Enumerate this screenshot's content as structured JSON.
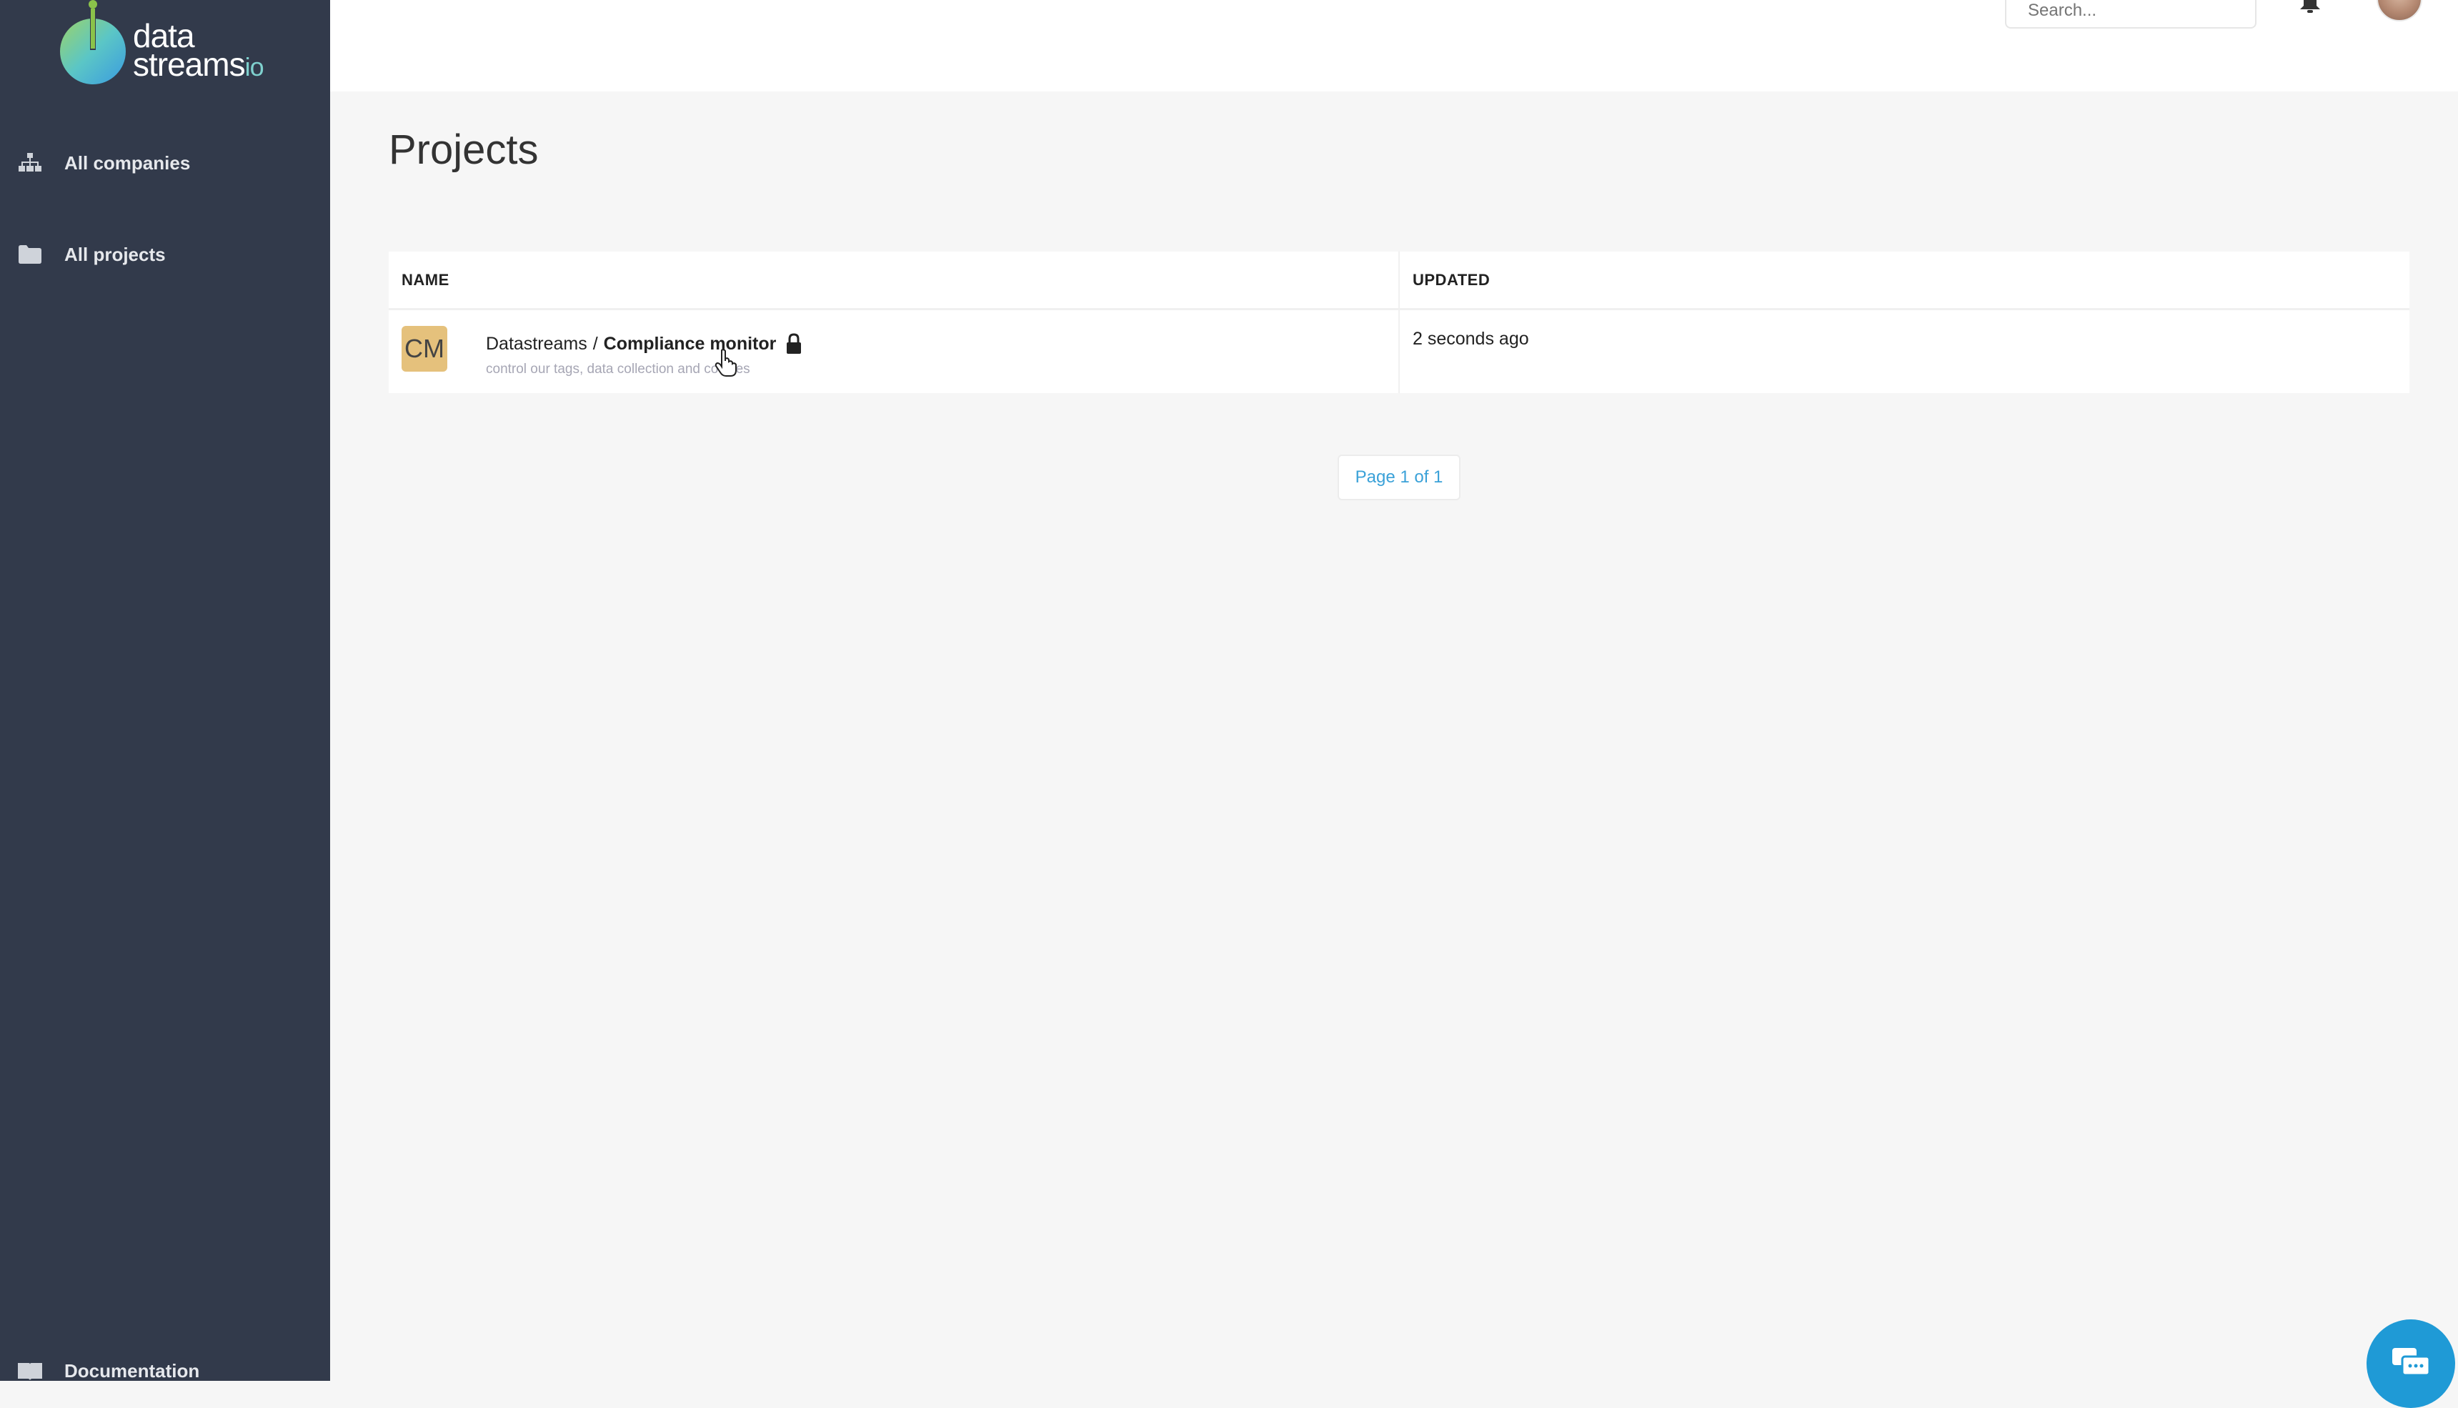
{
  "brand": {
    "logo_line1": "data",
    "logo_line2": "streams",
    "logo_suffix": "io"
  },
  "sidebar": {
    "items": [
      {
        "label": "All companies",
        "icon": "sitemap-icon"
      },
      {
        "label": "All projects",
        "icon": "folder-icon"
      }
    ],
    "footer": {
      "label": "Documentation",
      "icon": "book-icon"
    }
  },
  "header": {
    "search_placeholder": "Search...",
    "bell_icon": "bell-icon",
    "avatar_icon": "user-avatar"
  },
  "main": {
    "title": "Projects",
    "table": {
      "columns": [
        "NAME",
        "UPDATED"
      ],
      "rows": [
        {
          "badge": "CM",
          "company": "Datastreams",
          "separator": "/",
          "name": "Compliance monitor",
          "description": "control our tags, data collection and cookies",
          "locked": true,
          "updated": "2 seconds ago"
        }
      ]
    },
    "pagination": "Page 1 of 1"
  },
  "colors": {
    "sidebar_bg": "#323a4b",
    "accent_blue": "#3aa1d8",
    "badge_bg": "#e5c17c",
    "chat_bg": "#1f9ad6"
  }
}
